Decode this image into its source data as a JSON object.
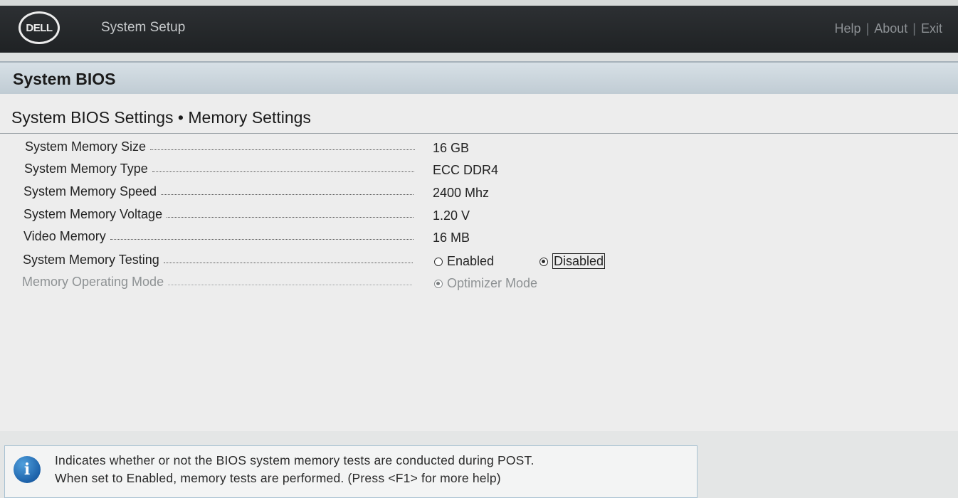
{
  "header": {
    "logo": "DELL",
    "app_title": "System Setup",
    "links": [
      "Help",
      "About",
      "Exit"
    ]
  },
  "banner": {
    "title": "System BIOS"
  },
  "section": {
    "title": "System BIOS Settings • Memory Settings"
  },
  "settings": [
    {
      "label": "System Memory Size",
      "value": "16 GB"
    },
    {
      "label": "System Memory Type",
      "value": "ECC DDR4"
    },
    {
      "label": "System Memory Speed",
      "value": "2400 Mhz"
    },
    {
      "label": "System Memory Voltage",
      "value": "1.20 V"
    },
    {
      "label": "Video Memory",
      "value": "16 MB"
    },
    {
      "label": "System Memory Testing",
      "options": [
        {
          "label": "Enabled",
          "selected": false
        },
        {
          "label": "Disabled",
          "selected": true
        }
      ]
    },
    {
      "label": "Memory Operating Mode",
      "options": [
        {
          "label": "Optimizer Mode",
          "selected": true
        }
      ]
    }
  ],
  "help": {
    "line1": "Indicates whether or not the BIOS system memory tests are conducted during POST.",
    "line2": "When set to Enabled, memory tests are performed. (Press <F1> for more help)"
  },
  "colors": {
    "header_bg": "#26292b",
    "banner_bg": "#c9d3da",
    "info_icon": "#1d62aa",
    "disabled_text": "#8e9294"
  }
}
